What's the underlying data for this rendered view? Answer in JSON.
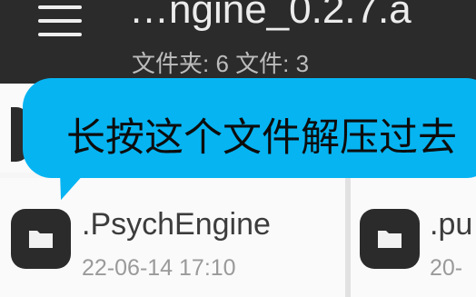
{
  "appbar": {
    "title": "…ngine_0.2.7.a",
    "subtitle": "文件夹: 6  文件: 3"
  },
  "files": [
    {
      "name": ".PsychEngine",
      "date": "22-06-14 17:10"
    },
    {
      "name": ".pu",
      "date": "20-"
    }
  ],
  "annotation": {
    "text": "长按这个文件解压过去"
  },
  "colors": {
    "appbar": "#2b2b2b",
    "bubble": "#06b4f2"
  }
}
